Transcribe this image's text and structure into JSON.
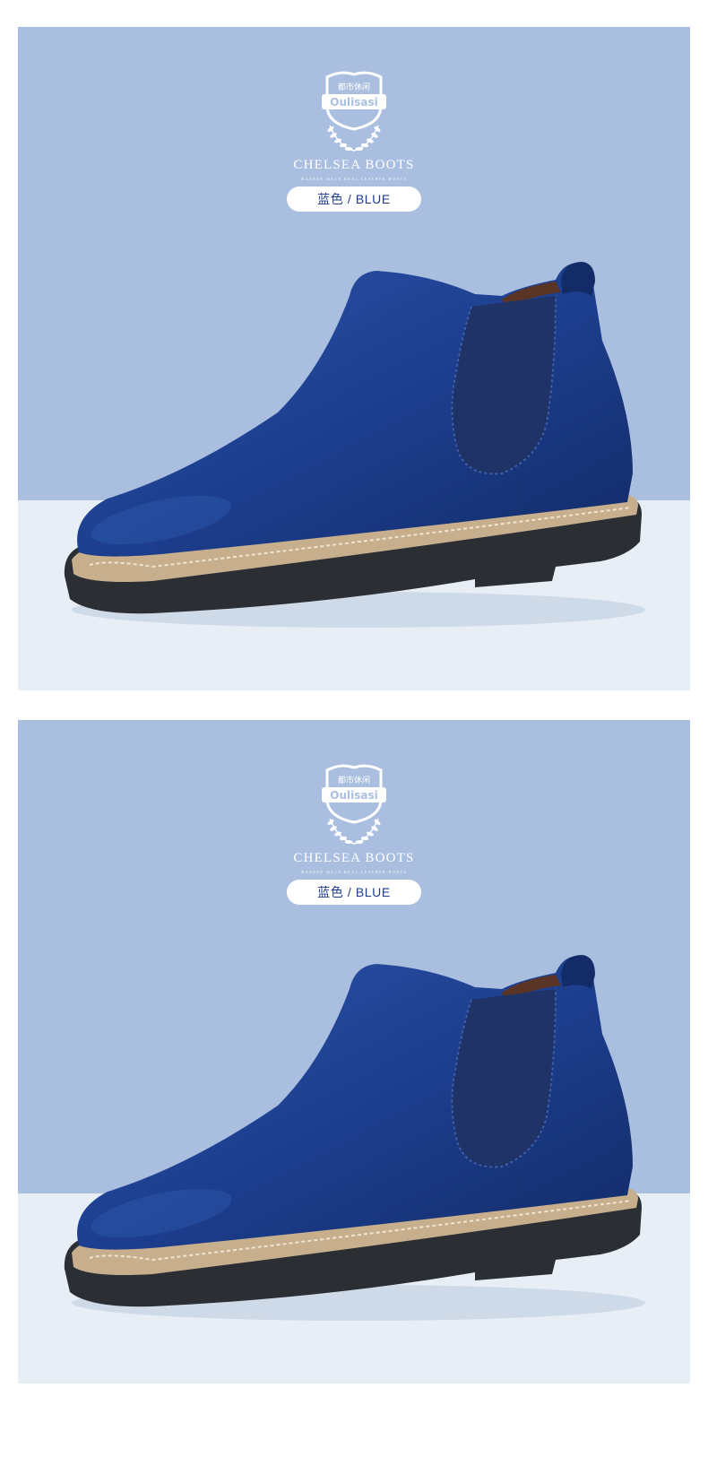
{
  "colors": {
    "background_top": "#AABFE0",
    "background_bottom": "#E7EEF6",
    "pill_background": "#FFFFFF",
    "pill_text": "#1E3D92",
    "boot_suede": "#1C3D8C",
    "boot_shadow": "#132C68",
    "elastic_panel": "#1F3366",
    "sole": "#2B2E33",
    "welt": "#C7AF8E"
  },
  "panels": [
    {
      "logo": {
        "icon": "shield-laurel-logo",
        "chinese_text": "都市休闲",
        "brand_text": "Oulisasi"
      },
      "title": "CHELSEA BOOTS",
      "subtitle": "MASHEN MALE REAL LEATHER BOOTS",
      "color_label": "蓝色 / BLUE",
      "product_image": "blue-suede-chelsea-boot"
    },
    {
      "logo": {
        "icon": "shield-laurel-logo",
        "chinese_text": "都市休闲",
        "brand_text": "Oulisasi"
      },
      "title": "CHELSEA BOOTS",
      "subtitle": "MASHEN MALE REAL LEATHER BOOTS",
      "color_label": "蓝色 / BLUE",
      "product_image": "blue-suede-chelsea-boot"
    }
  ]
}
